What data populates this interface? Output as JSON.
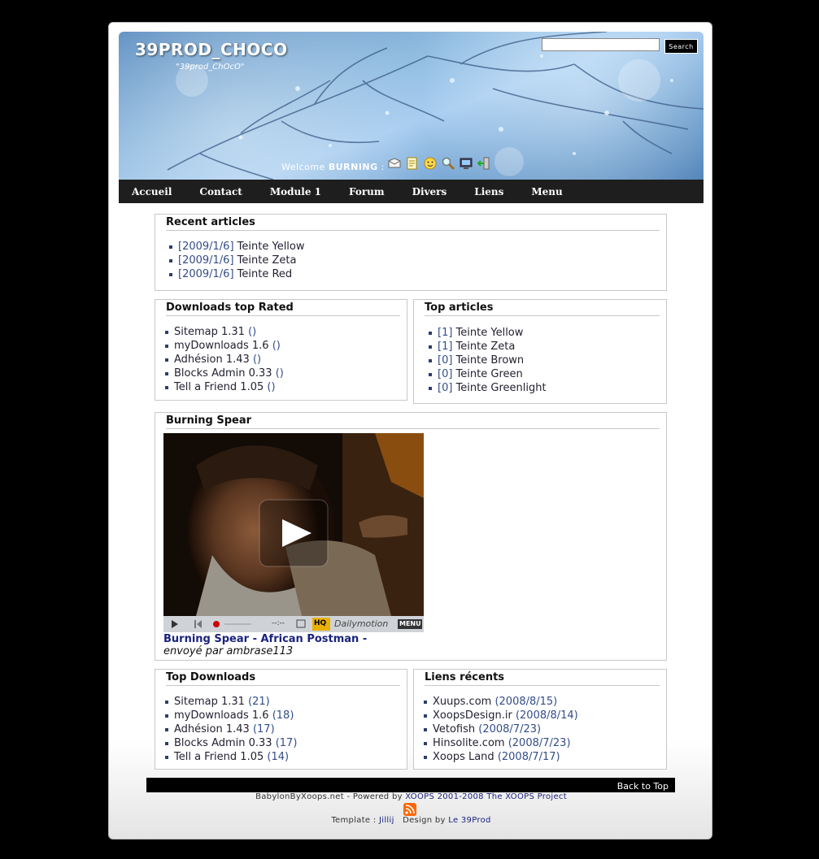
{
  "header": {
    "site_title": "39PROD_CHOCO",
    "slogan": "\"39prod_ChOcO\"",
    "search_placeholder": "",
    "search_button": "Search",
    "welcome_prefix": "Welcome",
    "username": "BURNING",
    "welcome_suffix": ":",
    "icons": [
      "inbox-icon",
      "edit-account-icon",
      "smiley-icon",
      "search-icon",
      "admin-icon",
      "logout-icon"
    ]
  },
  "nav": {
    "items": [
      "Accueil",
      "Contact",
      "Module 1",
      "Forum",
      "Divers",
      "Liens",
      "Menu"
    ]
  },
  "recent_articles": {
    "title": "Recent articles",
    "items": [
      {
        "date": "[2009/1/6]",
        "name": "Teinte Yellow"
      },
      {
        "date": "[2009/1/6]",
        "name": "Teinte Zeta"
      },
      {
        "date": "[2009/1/6]",
        "name": "Teinte Red"
      }
    ]
  },
  "downloads_top_rated": {
    "title": "Downloads top Rated",
    "items": [
      {
        "name": "Sitemap 1.31",
        "value": "()"
      },
      {
        "name": "myDownloads 1.6",
        "value": "()"
      },
      {
        "name": "Adhésion 1.43",
        "value": "()"
      },
      {
        "name": "Blocks Admin 0.33",
        "value": "()"
      },
      {
        "name": "Tell a Friend 1.05",
        "value": "()"
      }
    ]
  },
  "top_articles": {
    "title": "Top articles",
    "items": [
      {
        "count": "[1]",
        "name": "Teinte Yellow"
      },
      {
        "count": "[1]",
        "name": "Teinte Zeta"
      },
      {
        "count": "[0]",
        "name": "Teinte Brown"
      },
      {
        "count": "[0]",
        "name": "Teinte Green"
      },
      {
        "count": "[0]",
        "name": "Teinte Greenlight"
      }
    ]
  },
  "video": {
    "title": "Burning Spear",
    "caption_title": "Burning Spear - African Postman -",
    "caption_by": "envoyé par ambrase113",
    "player_brand": "Dailymotion",
    "player_hq": "HQ",
    "player_menu": "MENU",
    "player_time": "--:--"
  },
  "top_downloads": {
    "title": "Top Downloads",
    "items": [
      {
        "name": "Sitemap 1.31",
        "value": "(21)"
      },
      {
        "name": "myDownloads 1.6",
        "value": "(18)"
      },
      {
        "name": "Adhésion 1.43",
        "value": "(17)"
      },
      {
        "name": "Blocks Admin 0.33",
        "value": "(17)"
      },
      {
        "name": "Tell a Friend 1.05",
        "value": "(14)"
      }
    ]
  },
  "recent_links": {
    "title": "Liens récents",
    "items": [
      {
        "name": "Xuups.com",
        "date": "(2008/8/15)"
      },
      {
        "name": "XoopsDesign.ir",
        "date": "(2008/8/14)"
      },
      {
        "name": "Vetofish",
        "date": "(2008/7/23)"
      },
      {
        "name": "Hinsolite.com",
        "date": "(2008/7/23)"
      },
      {
        "name": "Xoops Land",
        "date": "(2008/7/17)"
      }
    ]
  },
  "footer": {
    "back_to_top": "Back to Top",
    "powered_prefix": "BabylonByXoops.net - Powered by",
    "powered_xoops": "XOOPS 2001-2008",
    "powered_project": "The XOOPS Project",
    "template_label": "Template :",
    "template_author": "Jillij",
    "design_label": "Design by",
    "design_author": "Le 39Prod"
  }
}
